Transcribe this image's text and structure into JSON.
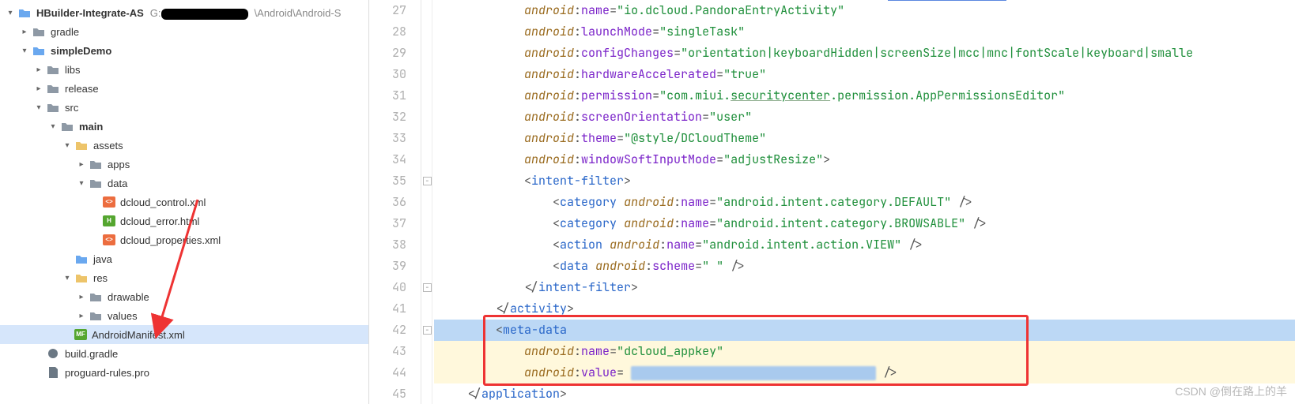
{
  "project": {
    "root_label": "HBuilder-Integrate-AS",
    "root_path_prefix": "G:",
    "root_path_suffix": "\\Android\\Android-S"
  },
  "tree": {
    "gradle": "gradle",
    "simpleDemo": "simpleDemo",
    "libs": "libs",
    "release": "release",
    "src": "src",
    "main": "main",
    "assets": "assets",
    "apps": "apps",
    "data": "data",
    "dcloud_control": "dcloud_control.xml",
    "dcloud_error": "dcloud_error.html",
    "dcloud_properties": "dcloud_properties.xml",
    "java": "java",
    "res": "res",
    "drawable": "drawable",
    "values": "values",
    "manifest": "AndroidManifest.xml",
    "build_gradle": "build.gradle",
    "proguard": "proguard-rules.pro"
  },
  "gutter": {
    "start": 27,
    "end": 45
  },
  "code": {
    "l27_ns": "android",
    "l27_attr": "name",
    "l27_val": "io.dcloud.PandoraEntryActivity",
    "l28_ns": "android",
    "l28_attr": "launchMode",
    "l28_val": "singleTask",
    "l29_ns": "android",
    "l29_attr": "configChanges",
    "l29_val": "orientation|keyboardHidden|screenSize|mcc|mnc|fontScale|keyboard|smalle",
    "l30_ns": "android",
    "l30_attr": "hardwareAccelerated",
    "l30_val": "true",
    "l31_ns": "android",
    "l31_attr": "permission",
    "l31_pre": "com.miui.",
    "l31_u": "securitycenter",
    "l31_post": ".permission.AppPermissionsEditor",
    "l32_ns": "android",
    "l32_attr": "screenOrientation",
    "l32_val": "user",
    "l33_ns": "android",
    "l33_attr": "theme",
    "l33_val": "@style/DCloudTheme",
    "l34_ns": "android",
    "l34_attr": "windowSoftInputMode",
    "l34_val": "adjustResize",
    "intent_filter": "intent-filter",
    "category": "category",
    "action": "action",
    "data_tag": "data",
    "attr_name": "name",
    "attr_scheme": "scheme",
    "cat_default": "android.intent.category.DEFAULT",
    "cat_browsable": "android.intent.category.BROWSABLE",
    "action_view": "android.intent.action.VIEW",
    "scheme_val": " ",
    "activity": "activity",
    "meta_data": "meta-data",
    "meta_name_val": "dcloud_appkey",
    "attr_value": "value",
    "application": "application"
  },
  "watermark": "CSDN @倒在路上的羊"
}
